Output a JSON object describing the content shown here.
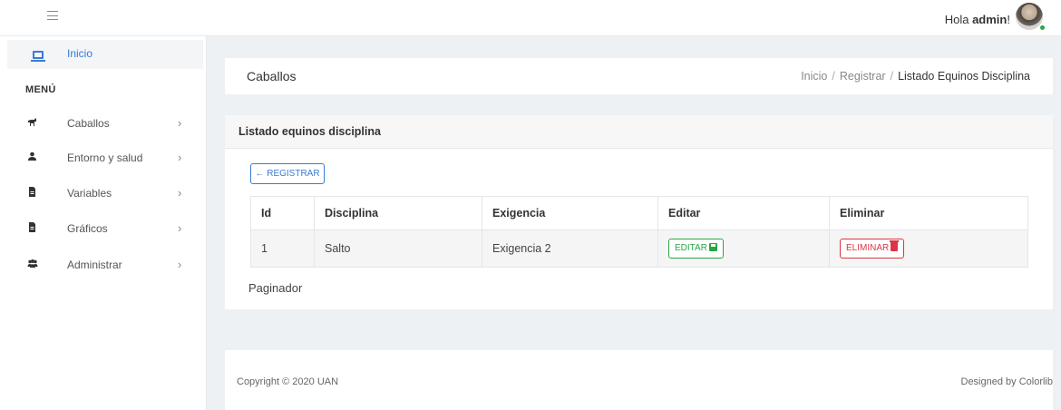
{
  "topbar": {
    "greeting_prefix": "Hola ",
    "username": "admin",
    "greeting_suffix": "!"
  },
  "sidebar": {
    "home_label": "Inicio",
    "menu_heading": "MENÚ",
    "items": [
      {
        "label": "Caballos",
        "icon": "horse-icon"
      },
      {
        "label": "Entorno y salud",
        "icon": "user-icon"
      },
      {
        "label": "Variables",
        "icon": "file-icon"
      },
      {
        "label": "Gráficos",
        "icon": "file-icon"
      },
      {
        "label": "Administrar",
        "icon": "users-icon"
      }
    ]
  },
  "page_header": {
    "title": "Caballos",
    "breadcrumb": [
      "Inicio",
      "Registrar",
      "Listado Equinos Disciplina"
    ]
  },
  "card": {
    "title": "Listado equinos disciplina",
    "register_button": "← REGISTRAR",
    "columns": [
      "Id",
      "Disciplina",
      "Exigencia",
      "Editar",
      "Eliminar"
    ],
    "rows": [
      {
        "id": "1",
        "disciplina": "Salto",
        "exigencia": "Exigencia 2",
        "edit_label": "EDITAR",
        "delete_label": "ELIMINAR"
      }
    ],
    "paginator": "Paginador"
  },
  "footer": {
    "copyright": "Copyright © 2020 UAN",
    "designed_by": "Designed by Colorlib"
  },
  "colors": {
    "accent": "#3a7bd5",
    "edit": "#28a745",
    "delete": "#dc3545"
  }
}
